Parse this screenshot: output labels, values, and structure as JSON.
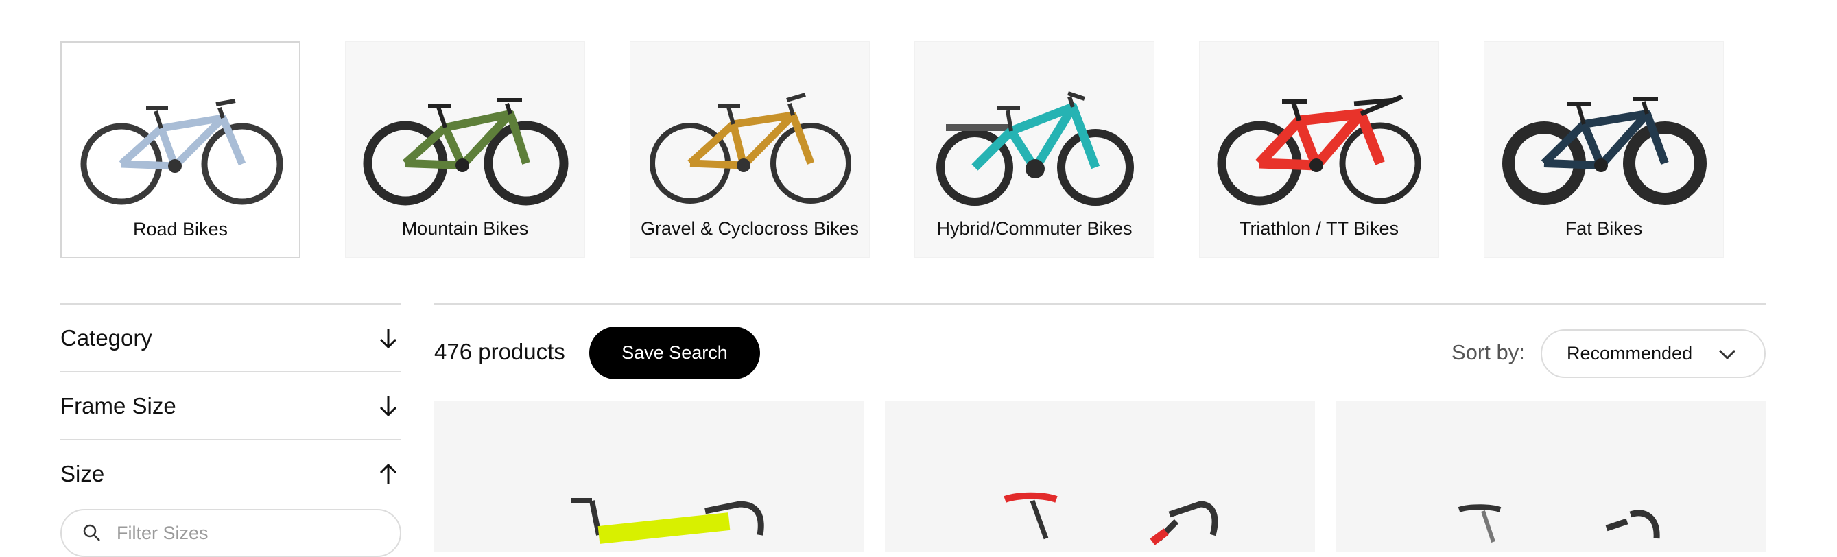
{
  "categories": [
    {
      "label": "Road Bikes",
      "icon": "road-bike-image",
      "selected": true,
      "color": "#a9bdd6"
    },
    {
      "label": "Mountain Bikes",
      "icon": "mountain-bike-image",
      "selected": false,
      "color": "#5e7f3a"
    },
    {
      "label": "Gravel & Cyclocross Bikes",
      "icon": "gravel-bike-image",
      "selected": false,
      "color": "#c8922a"
    },
    {
      "label": "Hybrid/Commuter Bikes",
      "icon": "hybrid-bike-image",
      "selected": false,
      "color": "#26b3b3"
    },
    {
      "label": "Triathlon / TT Bikes",
      "icon": "triathlon-bike-image",
      "selected": false,
      "color": "#e8332a"
    },
    {
      "label": "Fat Bikes",
      "icon": "fat-bike-image",
      "selected": false,
      "color": "#233a4d"
    }
  ],
  "filters": [
    {
      "label": "Category",
      "expanded": false
    },
    {
      "label": "Frame Size",
      "expanded": false
    },
    {
      "label": "Size",
      "expanded": true
    }
  ],
  "size_search": {
    "placeholder": "Filter Sizes"
  },
  "results": {
    "count_text": "476 products"
  },
  "save_search": {
    "label": "Save Search"
  },
  "sort": {
    "label": "Sort by:",
    "value": "Recommended"
  },
  "products": [
    {
      "icon": "bike-product-image",
      "accent": "#d8f000"
    },
    {
      "icon": "bike-product-image",
      "accent": "#e22b2b"
    },
    {
      "icon": "bike-product-image",
      "accent": "#8a8a8a"
    }
  ]
}
